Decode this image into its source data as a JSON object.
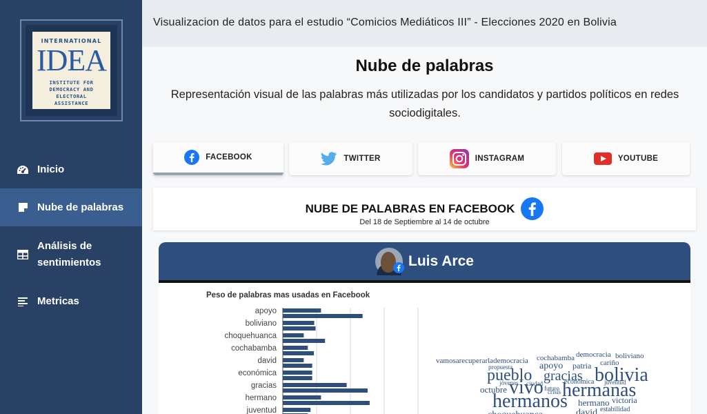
{
  "sidebar": {
    "logo": {
      "line1": "INTERNATIONAL",
      "line2": "IDEA",
      "line3a": "INSTITUTE FOR",
      "line3b": "DEMOCRACY AND",
      "line3c": "ELECTORAL",
      "line3d": "ASSISTANCE"
    },
    "items": [
      {
        "label": "Inicio",
        "icon": "dashboard-icon"
      },
      {
        "label": "Nube de palabras",
        "icon": "sticky-note-icon",
        "active": true
      },
      {
        "label": "Análisis de sentimientos",
        "icon": "table-icon"
      },
      {
        "label": "Metricas",
        "icon": "list-icon"
      }
    ]
  },
  "header": {
    "title": "Visualizacion de datos para el estudio “Comicios Mediáticos III” - Elecciones 2020 en Bolivia"
  },
  "main": {
    "title": "Nube de palabras",
    "description": "Representación visual de las palabras más utilizadas por los candidatos y partidos políticos en redes sociodigitales."
  },
  "tabs": [
    {
      "label": "FACEBOOK",
      "icon": "facebook-icon",
      "active": true
    },
    {
      "label": "TWITTER",
      "icon": "twitter-icon"
    },
    {
      "label": "INSTAGRAM",
      "icon": "instagram-icon"
    },
    {
      "label": "YOUTUBE",
      "icon": "youtube-icon"
    }
  ],
  "section": {
    "title": "NUBE DE PALABRAS EN FACEBOOK",
    "subtitle": "Del 18 de Septiembre al 14 de octubre"
  },
  "candidate": {
    "name": "Luis Arce"
  },
  "colors": {
    "sidebar": "#2a4166",
    "sidebar_active": "#3a5e8f",
    "accent": "#2e4f7e",
    "bar": "#2e4f7e"
  },
  "chart_data": {
    "type": "bar",
    "orientation": "horizontal",
    "title": "Peso de palabras mas usadas en Facebook",
    "categories": [
      "apoyo",
      "boliviano",
      "choquehuanca",
      "cochabamba",
      "david",
      "económica",
      "gracias",
      "hermano",
      "juventud"
    ],
    "series": [
      {
        "values": [
          0.113,
          0.093,
          0.062,
          0.074,
          0.062,
          0.087,
          0.189,
          0.113,
          0.082
        ]
      },
      {
        "values": [
          0.236,
          0.097,
          0.125,
          0.092,
          0.087,
          0.087,
          0.251,
          0.257,
          0.074
        ]
      }
    ],
    "xlim": [
      0,
      0.4
    ],
    "grid": true,
    "legend": "none"
  },
  "word_cloud": [
    {
      "text": "vamosarecuperarlademocracia",
      "size": 11
    },
    {
      "text": "democracia",
      "size": 11
    },
    {
      "text": "boliviano",
      "size": 11
    },
    {
      "text": "cochabamba",
      "size": 11
    },
    {
      "text": "propuesta",
      "size": 9
    },
    {
      "text": "cariño",
      "size": 11
    },
    {
      "text": "apoyo",
      "size": 14
    },
    {
      "text": "patria",
      "size": 12
    },
    {
      "text": "pueblo",
      "size": 24
    },
    {
      "text": "gracias",
      "size": 20
    },
    {
      "text": "bolivia",
      "size": 28
    },
    {
      "text": "jóvenes",
      "size": 9
    },
    {
      "text": "ciudad",
      "size": 9
    },
    {
      "text": "económica",
      "size": 10
    },
    {
      "text": "juventud",
      "size": 9
    },
    {
      "text": "octubre",
      "size": 13
    },
    {
      "text": "vivo",
      "size": 28
    },
    {
      "text": "futuro",
      "size": 9
    },
    {
      "text": "crisis",
      "size": 9
    },
    {
      "text": "hermanas",
      "size": 28
    },
    {
      "text": "victoria",
      "size": 12
    },
    {
      "text": "hermanos",
      "size": 28
    },
    {
      "text": "hermano",
      "size": 13
    },
    {
      "text": "david",
      "size": 14
    },
    {
      "text": "estabilidad",
      "size": 10
    },
    {
      "text": "choquehuanca",
      "size": 14
    }
  ]
}
